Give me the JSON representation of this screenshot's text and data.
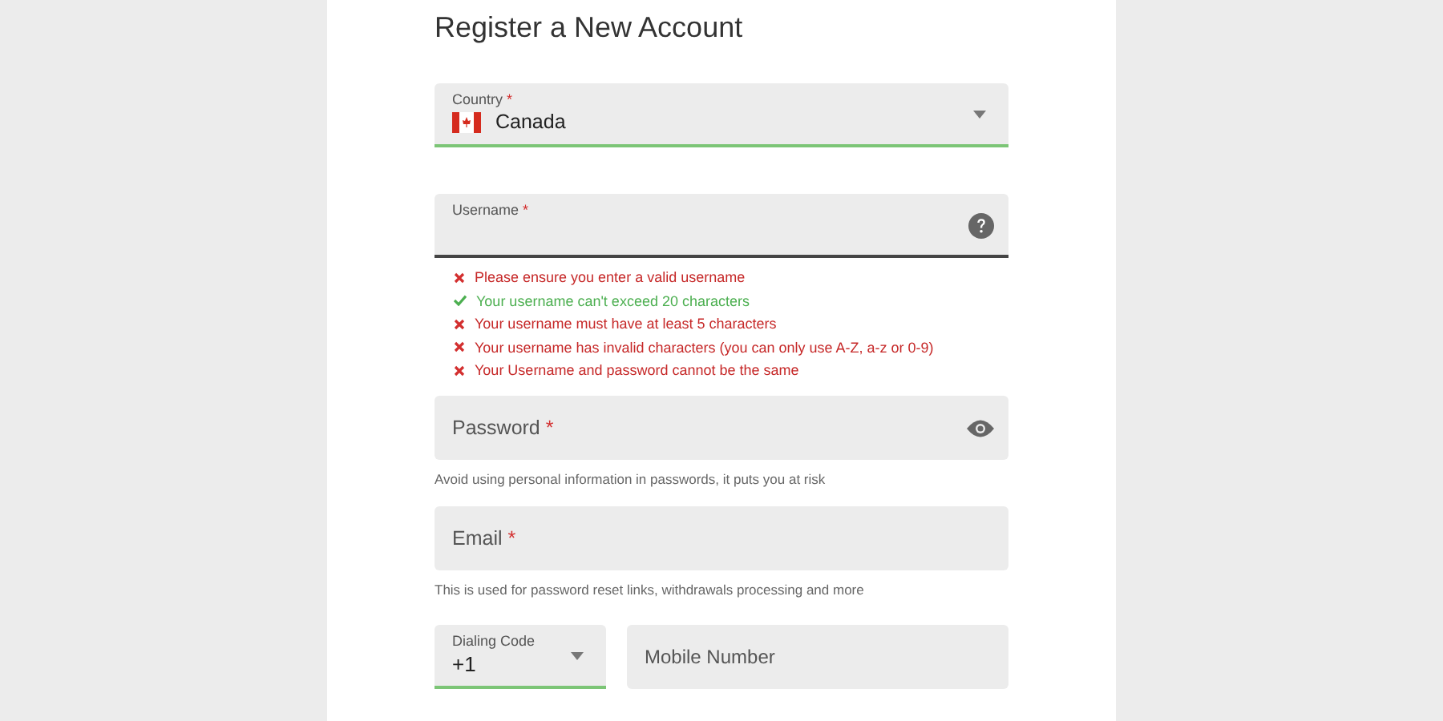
{
  "title": "Register a New Account",
  "country": {
    "label": "Country",
    "required_mark": "*",
    "value": "Canada",
    "valid": true
  },
  "username": {
    "label": "Username",
    "required_mark": "*",
    "focused": true,
    "rules": [
      {
        "text": "Please ensure you enter a valid username",
        "passed": false
      },
      {
        "text": "Your username can't exceed 20 characters",
        "passed": true
      },
      {
        "text": "Your username must have at least 5 characters",
        "passed": false
      },
      {
        "text": "Your username has invalid characters (you can only use A-Z, a-z or 0-9)",
        "passed": false
      },
      {
        "text": "Your Username and password cannot be the same",
        "passed": false
      }
    ]
  },
  "password": {
    "label": "Password",
    "required_mark": "*",
    "hint": "Avoid using personal information in passwords, it puts you at risk"
  },
  "email": {
    "label": "Email",
    "required_mark": "*",
    "hint": "This is used for password reset links, withdrawals processing and more"
  },
  "dialing_code": {
    "label": "Dialing Code",
    "value": "+1",
    "valid": true
  },
  "mobile": {
    "placeholder": "Mobile Number"
  }
}
